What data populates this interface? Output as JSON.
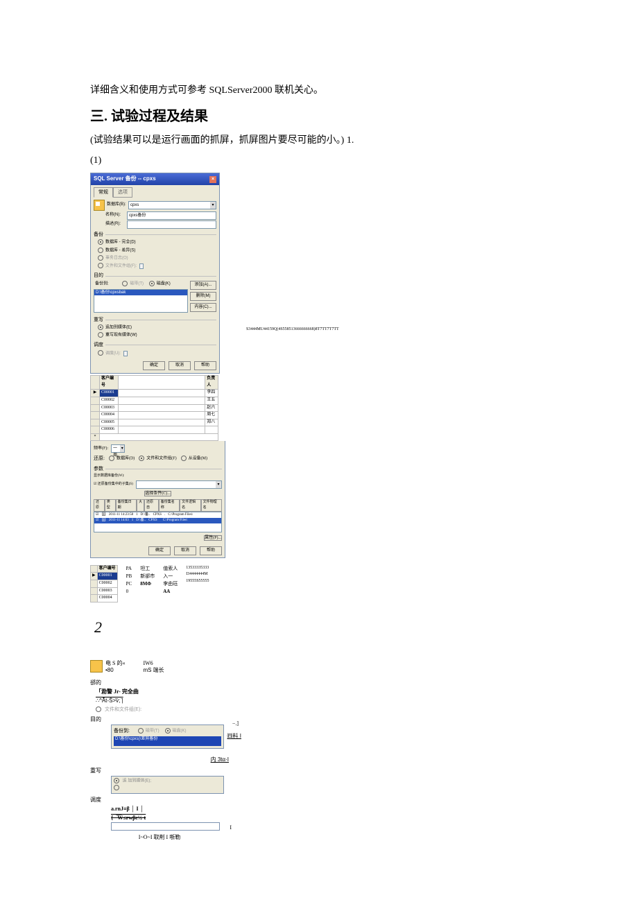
{
  "intro": "详细含义和使用方式可参考 SQLServer2000 联机关心。",
  "section": "三. 试验过程及结果",
  "sub1": "(试验结果可以是运行画面的抓屏，抓屏图片要尽可能的小。) 1.",
  "sub2": "(1)",
  "dlg1": {
    "title": "SQL Server 备份 -- cpxs",
    "tabGeneral": "常规",
    "tabOptions": "选项",
    "lblDb": "数据库(B):",
    "valDb": "cpxs",
    "lblName": "名称(N):",
    "valName": "cpxs备份",
    "lblDesc": "描述(R):",
    "sectBackup": "备份",
    "r1": "数据库 - 完全(D)",
    "r2": "数据库 - 差异(S)",
    "r3": "事务日志(O)",
    "r4": "文件和文件组(F):",
    "sectDest": "目的",
    "destLab": "备份到:",
    "destTape": "磁带(T)",
    "destDisk": "磁盘(K)",
    "destPath": "D:\\备份\\cpxsbak",
    "btnAdd": "添加(A)...",
    "btnDel": "删除(M)",
    "btnContent": "内容(C)...",
    "sectOver": "重写",
    "ov1": "追加到媒体(E)",
    "ov2": "重写现有媒体(W)",
    "sectSched": "调度",
    "schedChk": "调度(U):",
    "btnOk": "确定",
    "btnCancel": "取消",
    "btnHelp": "帮助"
  },
  "custHdr": "客户编号",
  "custRows": [
    "C00001",
    "C00002",
    "C00003",
    "C00004",
    "C00005",
    "C00006"
  ],
  "contactHdr": "负责人",
  "contacts": [
    "李四",
    "王五",
    "赵六",
    "周七",
    "郑八"
  ],
  "sideStr": "S3444MU44159Q(4S558513666666668)8T7TT7T7TT",
  "content": {
    "lblFreq": "频率(F):",
    "valFreq": "一周",
    "tabRestore": "还原:",
    "optDb": "数据库(D)",
    "optFilegrp": "文件和文件组(F)",
    "optFromDev": "从设备(M)",
    "lblParam": "参数",
    "lblShowBak": "显示数据库备份(W):",
    "lblFirstBak": "还原备份集中的子集(S)",
    "btnSelBak": "选择条件(C)...",
    "cols": [
      "还原",
      "类型",
      "备份集日期",
      "大",
      "还原自",
      "备份集名称",
      "文件逻辑名",
      "文件物理名"
    ],
    "row1": [
      "",
      "",
      "2011-11 14:23:58",
      "1",
      "D:\\备..",
      "CPXS",
      ".",
      "C:\\Program Files\\"
    ],
    "row2": [
      "",
      "",
      "2011-11 14:63",
      "1",
      "D:\\备..",
      "CPXS",
      "",
      "C:\\Program Files\\"
    ],
    "btnProp": "属性(P)...",
    "btnOk": "确定",
    "btnCancel": "取消",
    "btnHelp": "帮助"
  },
  "cust2": {
    "hdr": "客户编号",
    "rows": [
      "C00001",
      "C00002",
      "C00003",
      "C00004"
    ],
    "colC": [
      "",
      "PA",
      "PB",
      "PC",
      "0"
    ],
    "colD": [
      "坦工",
      "",
      "",
      "新郤市",
      "8MΦ"
    ],
    "colE": [
      "值索人",
      "入一",
      "李由珏",
      "AA"
    ],
    "colF": [
      "13533335333",
      "I34444444M",
      "19555S55555"
    ]
  },
  "num2": "2",
  "dlg2": {
    "hdrL1": "电  S  的«",
    "hdrL2": "•80",
    "hdrR1": "IW6",
    "hdrR2": "mS 端长",
    "sectMudi": "郤的",
    "r1": "「泐警 Jr- 完全曲",
    "r2": "∴^Â̄t-S̄>̄v̄;  ̄|",
    "r3": "文件和文件组(E):",
    "lblDest": "目的",
    "destLab": "备份到:",
    "destTape": "磁带(T)",
    "destDisk": "磁盘(K)",
    "destPath": "D:\\备份\\cpxs(\\差异备份",
    "rbtn": "㈣料 I",
    "rbtn2": "内 3tα·I",
    "sectOver": "重写",
    "ovtxt": "追 加到媒体(E);",
    "sectSched": "调度",
    "schedA": "a.rnJ≡β │ I │",
    "schedB": "{周̶̅W̅≤rwβc½·t",
    "rightJ": "−.]",
    "rightI": "I",
    "foot": "I~O~I 取剤 I 哳勒"
  }
}
